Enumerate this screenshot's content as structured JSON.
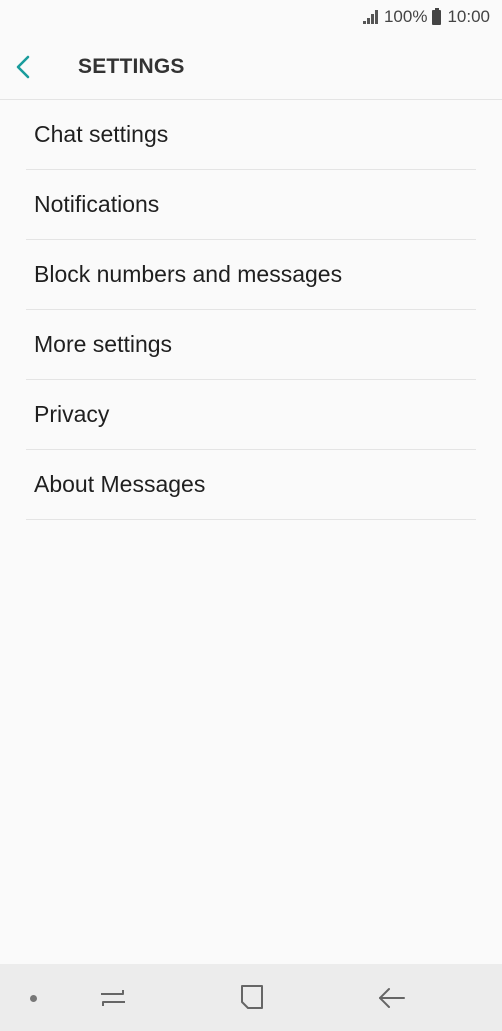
{
  "status_bar": {
    "battery_percent": "100%",
    "time": "10:00",
    "icons": [
      "signal-icon",
      "battery-icon"
    ]
  },
  "app_bar": {
    "title": "SETTINGS",
    "back_icon": "chevron-left-icon",
    "accent_color": "#1a9c9c"
  },
  "menu": {
    "items": [
      {
        "label": "Chat settings"
      },
      {
        "label": "Notifications"
      },
      {
        "label": "Block numbers and messages"
      },
      {
        "label": "More settings"
      },
      {
        "label": "Privacy"
      },
      {
        "label": "About Messages"
      }
    ]
  },
  "nav_bar": {
    "icons": [
      "nav-dot-icon",
      "recents-icon",
      "home-icon",
      "back-arrow-icon"
    ]
  }
}
